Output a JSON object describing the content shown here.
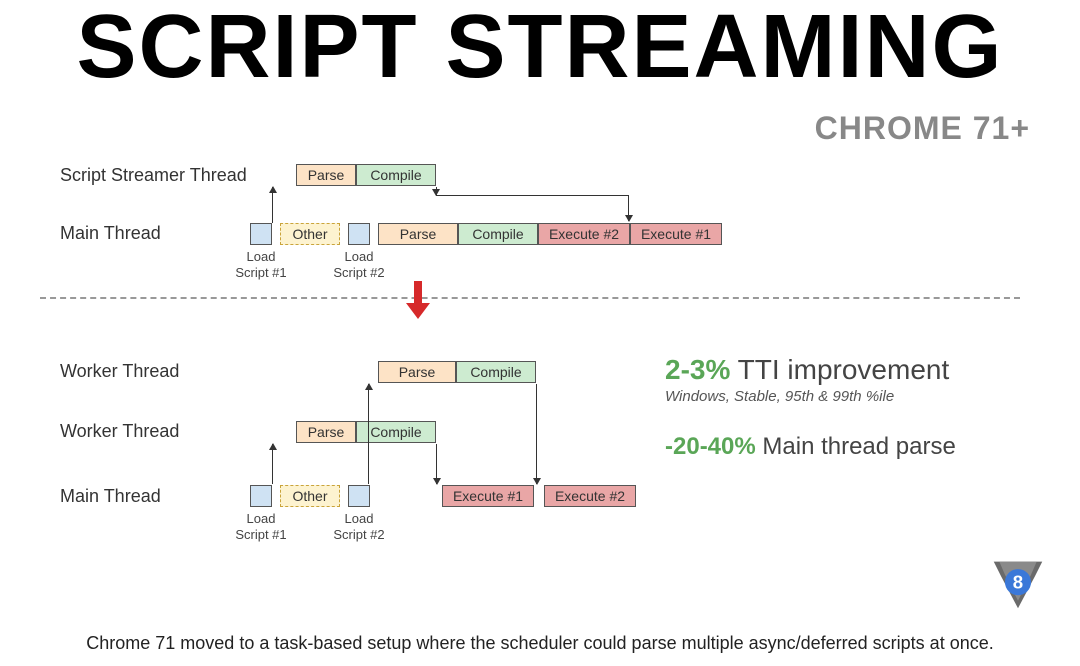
{
  "title": "SCRIPT STREAMING",
  "subtitle": "CHROME 71+",
  "labels": {
    "streamer": "Script Streamer Thread",
    "main": "Main Thread",
    "worker": "Worker Thread",
    "load1": "Load\nScript #1",
    "load2": "Load\nScript #2"
  },
  "blocks": {
    "parse": "Parse",
    "compile": "Compile",
    "other": "Other",
    "exec1": "Execute #1",
    "exec2": "Execute #2"
  },
  "stats": {
    "tti_pct": "2-3%",
    "tti_label": "TTI improvement",
    "tti_sub": "Windows, Stable, 95th & 99th %ile",
    "parse_pct": "-20-40%",
    "parse_label": "Main thread parse"
  },
  "footer": "Chrome 71 moved to a task-based setup where the scheduler could parse multiple async/deferred scripts at once.",
  "v8_label": "8"
}
